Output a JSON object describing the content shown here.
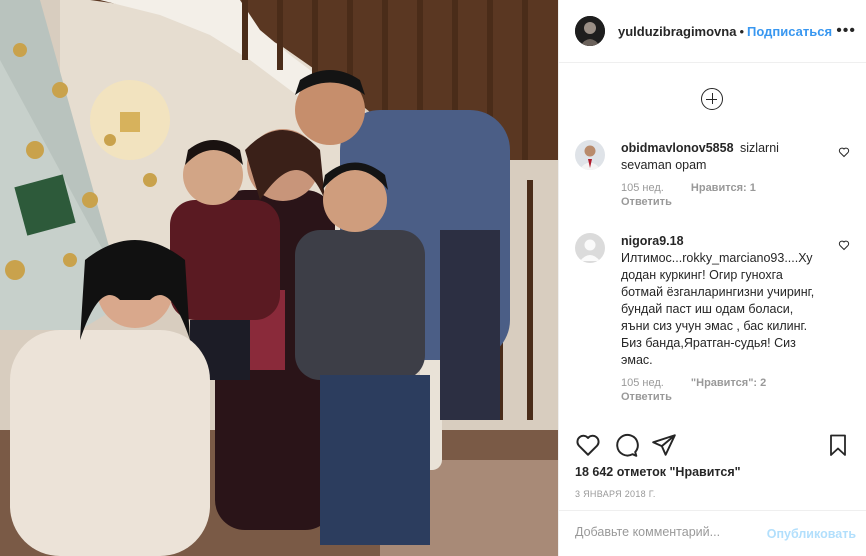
{
  "post": {
    "author": "yulduzibragimovna",
    "separator": "•",
    "follow_label": "Подписаться",
    "more_label": "•••"
  },
  "comments": [
    {
      "user": "obidmavlonov5858",
      "text": "sizlarni sevaman opam",
      "age": "105 нед.",
      "likes": "Нравится: 1",
      "reply": "Ответить"
    },
    {
      "user": "nigora9.18",
      "text": "Илтимос...rokky_marciano93....Ху додан куркинг! Огир гунохга ботмай ёзганларингизни учиринг, бундай паст иш одам боласи, яъни сиз учун эмас , бас килинг. Биз банда,Яратган-судья! Сиз эмас.",
      "age": "105 нед.",
      "likes": "\"Нравится\": 2",
      "reply": "Ответить"
    }
  ],
  "stats": {
    "likes": "18 642 отметок \"Нравится\"",
    "date": "3 января 2018 г."
  },
  "add_comment": {
    "placeholder": "Добавьте комментарий...",
    "post_label": "Опубликовать"
  },
  "icons": {
    "load_more": "plus-circle-icon",
    "like": "heart-icon",
    "comment": "comment-bubble-icon",
    "share": "paper-plane-icon",
    "save": "bookmark-icon",
    "comment_like": "small-heart-icon"
  },
  "colors": {
    "accent": "#3897f0",
    "text": "#262626",
    "muted": "#999999",
    "post_disabled": "#b2dffc",
    "border": "#efefef"
  }
}
